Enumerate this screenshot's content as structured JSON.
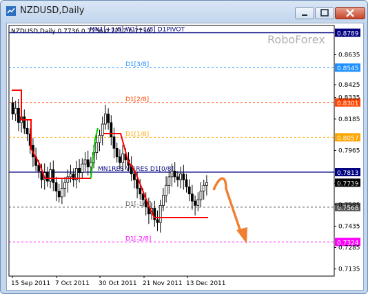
{
  "window": {
    "title": "NZDUSD,Daily"
  },
  "chart": {
    "symbol_info": "NZDUSD,Daily  0.7736 0.7756 0.7717 0.7739",
    "watermark": "RoboForex",
    "levels": [
      {
        "label": "MN1[+1/8] W1[+1/8] D1PIVOT",
        "price": 0.8789,
        "price_label": "0.8789",
        "color": "#000080",
        "style": "solid"
      },
      {
        "label": "D1[3/8]",
        "price": 0.8545,
        "price_label": "0.8545",
        "color": "#1e90ff",
        "style": "dashed"
      },
      {
        "label": "D1[2/8]",
        "price": 0.8301,
        "price_label": "0.8301",
        "color": "#ff4500",
        "style": "dashed"
      },
      {
        "label": "D1[1/8]",
        "price": 0.8057,
        "price_label": "0.8057",
        "color": "#ffa500",
        "style": "dashed"
      },
      {
        "label": "MN1RES W1RES D1[0/8]",
        "price": 0.7813,
        "price_label": "0.7813",
        "color": "#000080",
        "style": "solid"
      },
      {
        "label": "D1[-1/8]",
        "price": 0.7568,
        "price_label": "0.7568",
        "color": "#555555",
        "style": "dashed"
      },
      {
        "label": "D1[-2/8]",
        "price": 0.7324,
        "price_label": "0.7324",
        "color": "#ff00ff",
        "style": "dashed"
      }
    ],
    "current_price": {
      "price": 0.7739,
      "label": "0.7739"
    },
    "y_ticks": [
      "0.8635",
      "0.8425",
      "0.8335",
      "0.8185",
      "0.7965",
      "0.7735",
      "0.7585",
      "0.7435",
      "0.7285",
      "0.7135"
    ],
    "x_ticks": [
      "15 Sep 2011",
      "7 Oct 2011",
      "30 Oct 2011",
      "21 Nov 2011",
      "13 Dec 2011"
    ],
    "ylim": [
      0.7085,
      0.884
    ],
    "colors": {
      "candle": "#000000",
      "stop_line_down": "#ff0000",
      "stop_line_up": "#00cc00",
      "forecast_arrow": "#f08030"
    }
  }
}
